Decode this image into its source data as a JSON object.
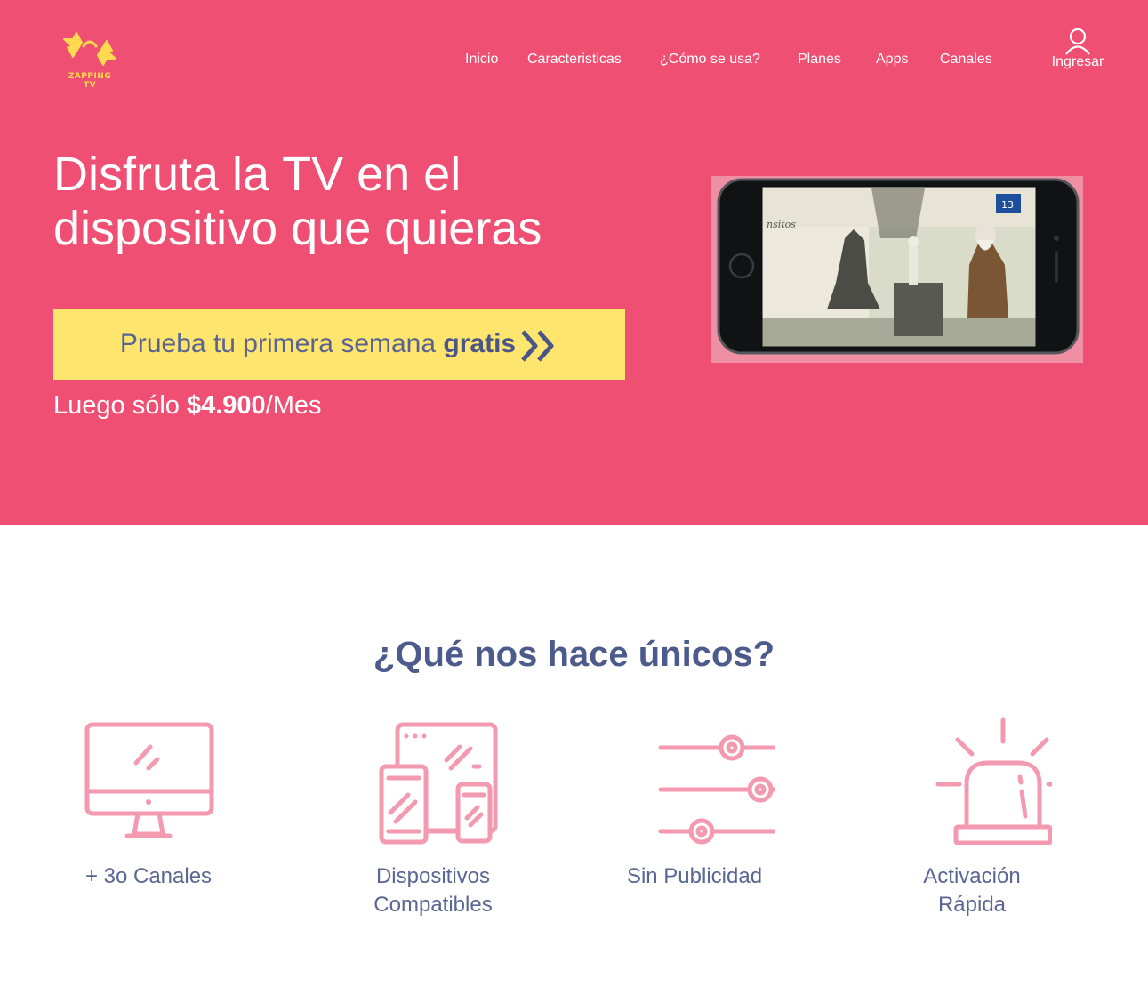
{
  "brand": {
    "logo_text": "ZAPPING TV"
  },
  "nav": {
    "items": [
      "Inicio",
      "Caracteristicas",
      "¿Cómo se usa?",
      "Planes",
      "Apps",
      "Canales"
    ],
    "login_label": "Ingresar"
  },
  "hero": {
    "title_line1": "Disfruta la TV en el",
    "title_line2": "dispositivo que quieras",
    "cta_text": "Prueba tu primera semana",
    "cta_bold": "gratis",
    "price_prefix": "Luego sólo",
    "price_value": "$4.900",
    "price_suffix": "/Mes"
  },
  "features": {
    "title": "¿Qué nos hace únicos?",
    "items": [
      {
        "icon": "monitor-icon",
        "label_line1": "+ 3o Canales",
        "label_line2": ""
      },
      {
        "icon": "devices-icon",
        "label_line1": "Dispositivos",
        "label_line2": "Compatibles"
      },
      {
        "icon": "sliders-icon",
        "label_line1": "Sin Publicidad",
        "label_line2": ""
      },
      {
        "icon": "siren-icon",
        "label_line1": "Activación",
        "label_line2": "Rápida"
      }
    ]
  },
  "colors": {
    "hero_bg": "#f04f74",
    "cta_bg": "#fde56e",
    "accent_navy": "#4c5a8c",
    "icon_pink": "#f49ab0",
    "logo_yellow": "#ffd94e"
  }
}
